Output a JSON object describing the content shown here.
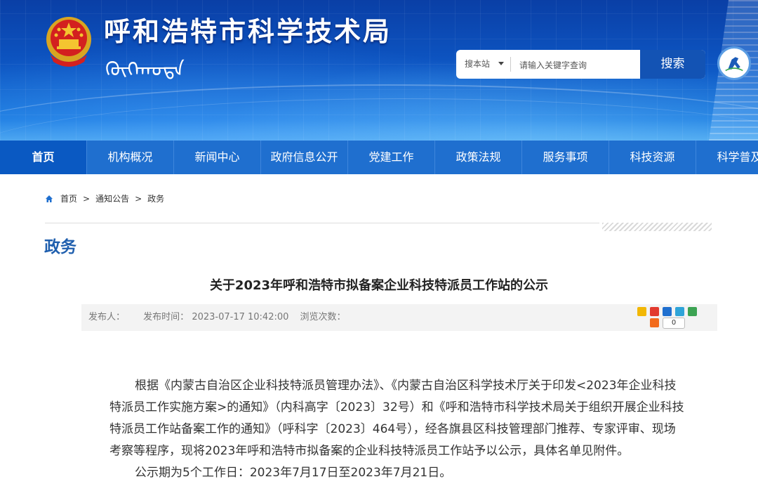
{
  "header": {
    "site_title": "呼和浩特市科学技术局",
    "mongolian_script": "ᠬᠥᠬᠡᠬᠣᠲᠠ",
    "search": {
      "scope": "搜本站",
      "placeholder": "请输入关键字查询",
      "button": "搜索"
    }
  },
  "nav": {
    "items": [
      "首页",
      "机构概况",
      "新闻中心",
      "政府信息公开",
      "党建工作",
      "政策法规",
      "服务事项",
      "科技资源",
      "科学普及"
    ],
    "active_index": 0
  },
  "breadcrumb": {
    "items": [
      "首页",
      "通知公告",
      "政务"
    ],
    "separator": ">"
  },
  "section": {
    "title": "政务"
  },
  "article": {
    "title": "关于2023年呼和浩特市拟备案企业科技特派员工作站的公示",
    "meta": {
      "publisher_label": "发布人：",
      "time_label": "发布时间：",
      "time": "2023-07-17 10:42:00",
      "views_label": "浏览次数："
    },
    "share_count": "0",
    "paragraphs": [
      "根据《内蒙古自治区企业科技特派员管理办法》、《内蒙古自治区科学技术厅关于印发<2023年企业科技特派员工作实施方案>的通知》（内科高字〔2023〕32号）和《呼和浩特市科学技术局关于组织开展企业科技特派员工作站备案工作的通知》（呼科字〔2023〕464号），经各旗县区科技管理部门推荐、专家评审、现场考察等程序，现将2023年呼和浩特市拟备案的企业科技特派员工作站予以公示，具体名单见附件。",
      "公示期为5个工作日：2023年7月17日至2023年7月21日。"
    ]
  },
  "colors": {
    "nav_bg": "#1f6fcf",
    "nav_active": "#0a59c2",
    "section_title": "#1f5fae",
    "search_button": "#1353b4"
  }
}
